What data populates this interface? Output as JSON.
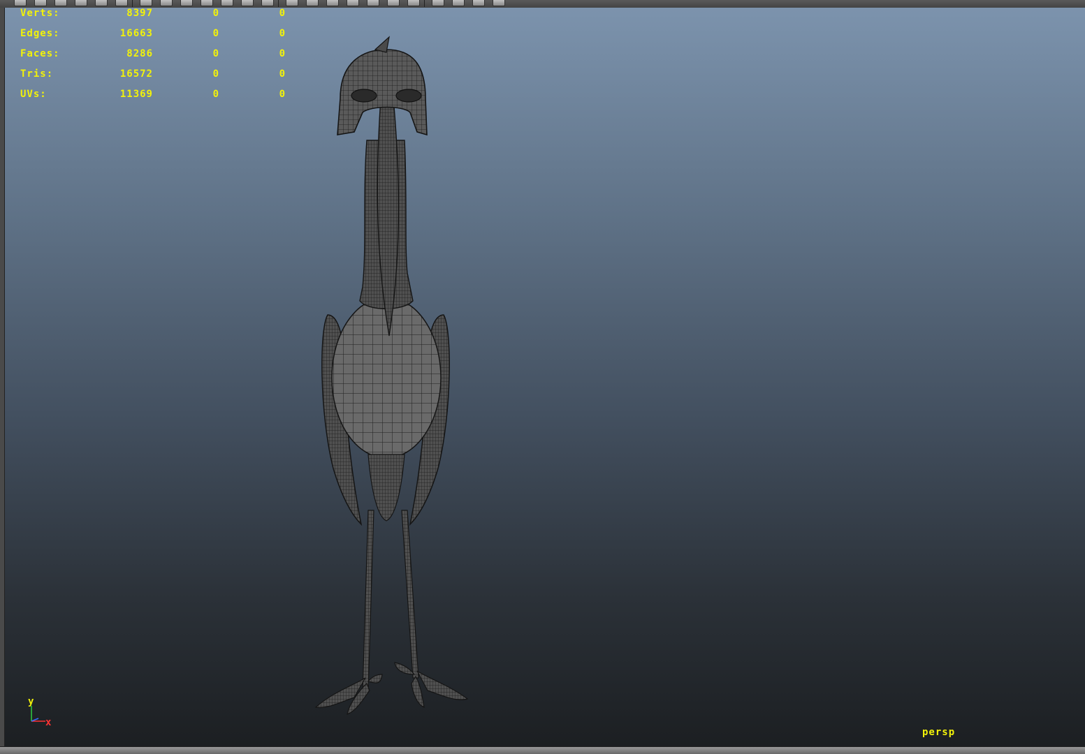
{
  "toolbar": {
    "icons": [
      "select-tool-icon",
      "lasso-tool-icon",
      "paint-tool-icon",
      "move-tool-icon",
      "rotate-tool-icon",
      "scale-tool-icon",
      "camera-icon",
      "render-icon",
      "ipr-render-icon",
      "render-settings-icon",
      "hypershade-icon",
      "grid-icon",
      "film-gate-icon",
      "wireframe-icon",
      "smooth-shade-icon",
      "textured-icon",
      "lights-icon",
      "shadows-icon",
      "xray-icon",
      "isolate-icon",
      "highlight-icon",
      "bookmark-icon",
      "frame-icon",
      "camera-attr-icon"
    ]
  },
  "hud": {
    "rows": [
      {
        "label": "Verts:",
        "v1": "8397",
        "v2": "0",
        "v3": "0"
      },
      {
        "label": "Edges:",
        "v1": "16663",
        "v2": "0",
        "v3": "0"
      },
      {
        "label": "Faces:",
        "v1": "8286",
        "v2": "0",
        "v3": "0"
      },
      {
        "label": "Tris:",
        "v1": "16572",
        "v2": "0",
        "v3": "0"
      },
      {
        "label": "UVs:",
        "v1": "11369",
        "v2": "0",
        "v3": "0"
      }
    ],
    "color": "#f2f20a"
  },
  "viewport": {
    "camera": "persp",
    "axis": {
      "y": "y",
      "x": "x"
    },
    "gradient_top": "#7c93ad",
    "gradient_bottom": "#1c1f22"
  },
  "model": {
    "name": "stork-bird-wireframe-model"
  }
}
